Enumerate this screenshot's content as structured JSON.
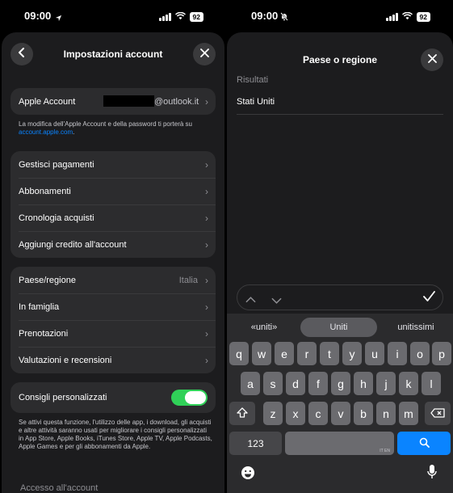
{
  "status": {
    "time": "09:00",
    "battery": "92"
  },
  "left": {
    "title": "Impostazioni account",
    "apple_account": {
      "label": "Apple Account",
      "email_suffix": "@outlook.it"
    },
    "account_note": "La modifica dell'Apple Account e della password ti porterà su",
    "account_link": "account.apple.com",
    "account_link_suffix": ".",
    "group2": [
      "Gestisci pagamenti",
      "Abbonamenti",
      "Cronologia acquisti",
      "Aggiungi credito all'account"
    ],
    "group3": [
      {
        "label": "Paese/regione",
        "value": "Italia"
      },
      {
        "label": "In famiglia"
      },
      {
        "label": "Prenotazioni"
      },
      {
        "label": "Valutazioni e recensioni"
      }
    ],
    "personalized": {
      "label": "Consigli personalizzati",
      "enabled": true
    },
    "personalized_note": "Se attivi questa funzione, l'utilizzo delle app, i download, gli acquisti e altre attività saranno usati per migliorare i consigli personalizzati in App Store, Apple Books, iTunes Store, Apple TV, Apple Podcasts, Apple Games e per gli abbonamenti da Apple.",
    "section_access": "Accesso all'account"
  },
  "right": {
    "title": "Paese o regione",
    "results_label": "Risultati",
    "result": "Stati Uniti",
    "suggestions": [
      "«uniti»",
      "Uniti",
      "unitissimi"
    ],
    "keys_row1": [
      "q",
      "w",
      "e",
      "r",
      "t",
      "y",
      "u",
      "i",
      "o",
      "p"
    ],
    "keys_row2": [
      "a",
      "s",
      "d",
      "f",
      "g",
      "h",
      "j",
      "k",
      "l"
    ],
    "keys_row3": [
      "z",
      "x",
      "c",
      "v",
      "b",
      "n",
      "m"
    ],
    "numbers_key": "123",
    "space_hint": "IT EN"
  },
  "colors": {
    "accent": "#0a84ff",
    "toggle_on": "#30d158",
    "sheet": "#1c1c1e",
    "cell": "#2c2c2e"
  }
}
